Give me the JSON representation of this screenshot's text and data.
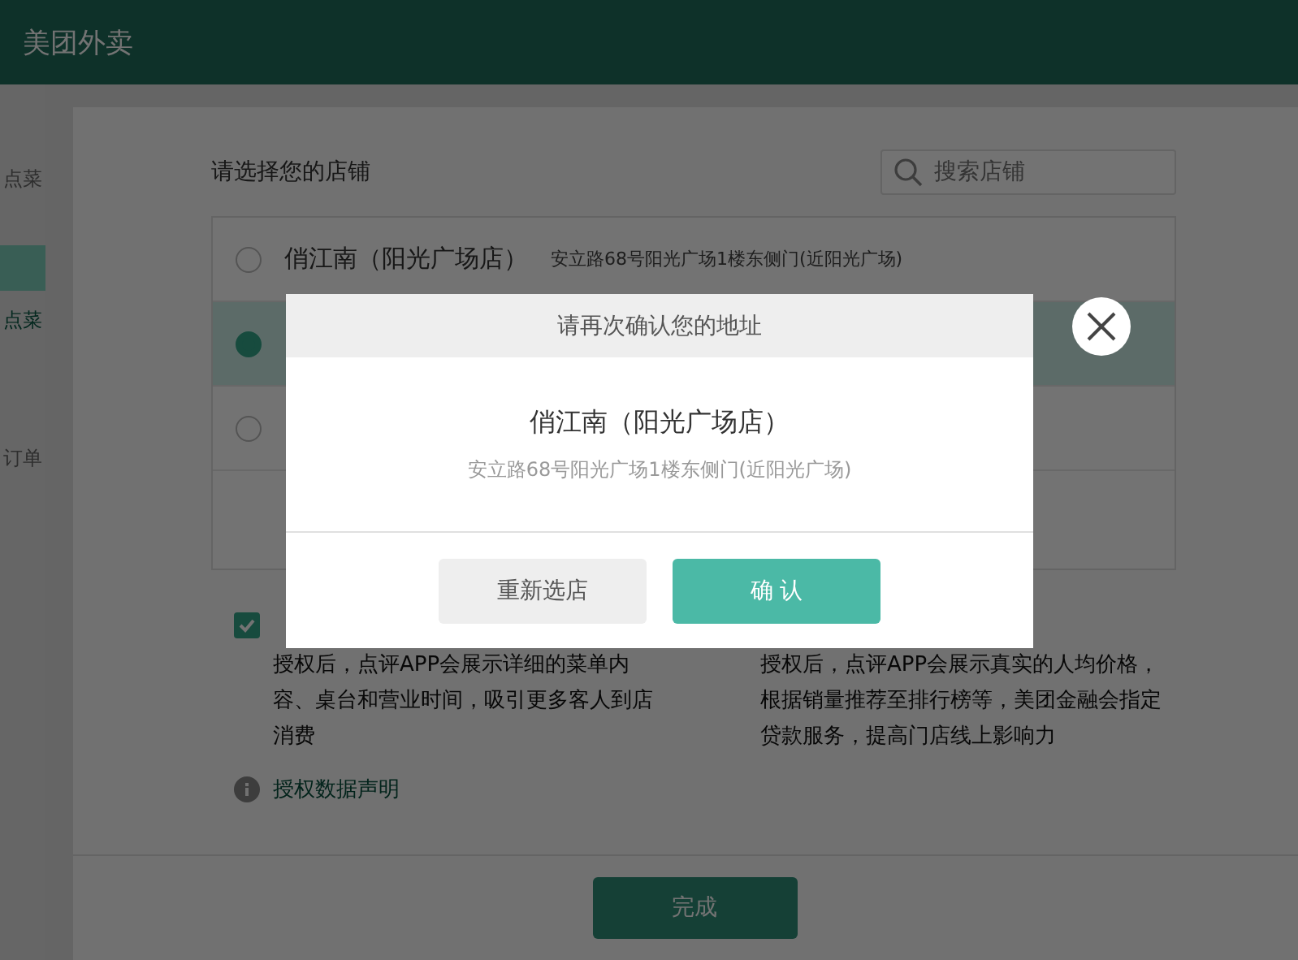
{
  "app": {
    "title": "美团外卖"
  },
  "sidebar": {
    "items": [
      {
        "label": "点菜",
        "selected": false
      },
      {
        "label": "点菜",
        "selected": true
      },
      {
        "label": "订单",
        "selected": false
      }
    ]
  },
  "store_picker": {
    "title": "请选择您的店铺",
    "search": {
      "placeholder": "搜索店铺"
    },
    "stores": [
      {
        "name": "俏江南（阳光广场店）",
        "address": "安立路68号阳光广场1楼东侧门(近阳光广场)",
        "selected": false
      },
      {
        "selected": true
      },
      {
        "selected": false
      }
    ]
  },
  "authorizations": [
    {
      "checked": true,
      "description": "授权后，点评APP会展示详细的菜单内容、桌台和营业时间，吸引更多客人到店消费"
    },
    {
      "description": "授权后，点评APP会展示真实的人均价格，根据销量推荐至排行榜等，美团金融会指定贷款服务，提高门店线上影响力"
    }
  ],
  "info_link": "授权数据声明",
  "done_button": "完成",
  "dialog": {
    "title": "请再次确认您的地址",
    "store_name": "俏江南（阳光广场店）",
    "address": "安立路68号阳光广场1楼东侧门(近阳光广场)",
    "buttons": [
      {
        "label": "重新选店",
        "kind": "secondary"
      },
      {
        "label": "确 认",
        "kind": "primary"
      }
    ]
  }
}
